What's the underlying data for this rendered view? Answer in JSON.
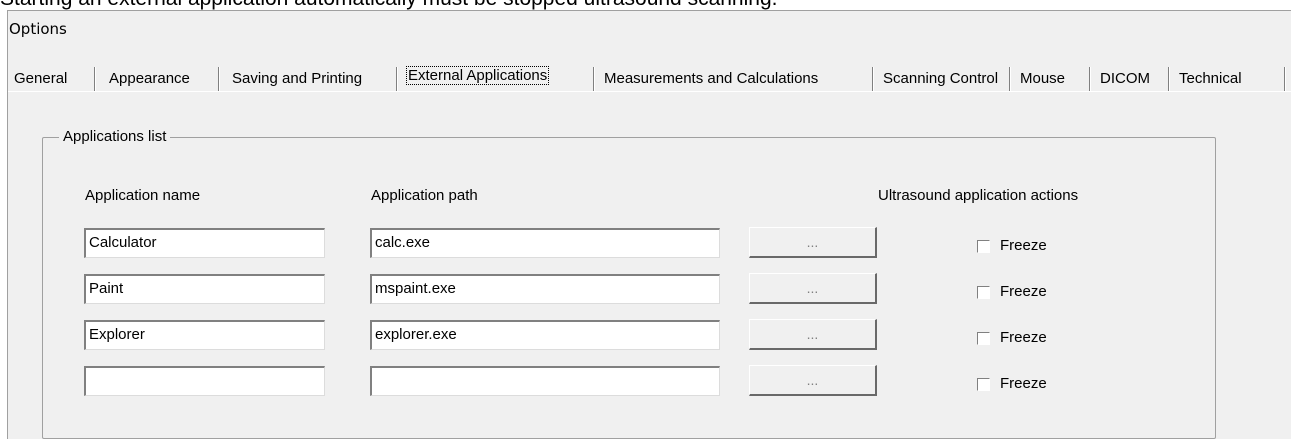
{
  "banner_text": "Starting an external application automatically must be stopped ultrasound scanning.",
  "window": {
    "title": "Options"
  },
  "tabs": [
    {
      "label": "General"
    },
    {
      "label": "Appearance"
    },
    {
      "label": "Saving and Printing"
    },
    {
      "label": "External Applications",
      "active": true
    },
    {
      "label": "Measurements and Calculations"
    },
    {
      "label": "Scanning Control"
    },
    {
      "label": "Mouse"
    },
    {
      "label": "DICOM"
    },
    {
      "label": "Technical"
    }
  ],
  "applications_list": {
    "group_title": "Applications list",
    "headers": {
      "name": "Application name",
      "path": "Application path",
      "actions": "Ultrasound application actions"
    },
    "browse_label": "...",
    "rows": [
      {
        "name": "Calculator",
        "path": "calc.exe",
        "freeze_label": "Freeze",
        "freeze_checked": false
      },
      {
        "name": "Paint",
        "path": "mspaint.exe",
        "freeze_label": "Freeze",
        "freeze_checked": false
      },
      {
        "name": "Explorer",
        "path": "explorer.exe",
        "freeze_label": "Freeze",
        "freeze_checked": false
      },
      {
        "name": "",
        "path": "",
        "freeze_label": "Freeze",
        "freeze_checked": false
      }
    ]
  },
  "colors": {
    "dialog_bg": "#f0f0f0",
    "field_bg": "#ffffff",
    "border": "#a0a0a0"
  }
}
